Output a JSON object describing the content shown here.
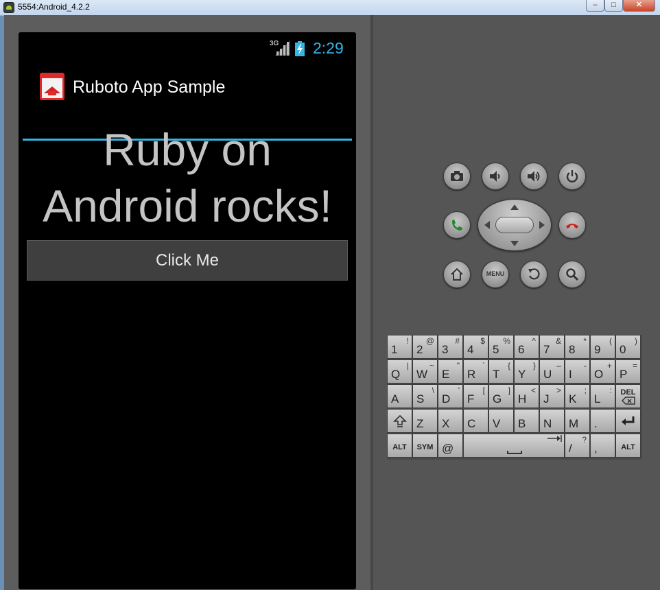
{
  "window": {
    "title": "5554:Android_4.2.2",
    "min": "–",
    "max": "□",
    "close": "✕"
  },
  "status": {
    "network": "3G",
    "time": "2:29",
    "accent": "#33b5e5"
  },
  "app": {
    "title": "Ruboto App Sample",
    "headline_1": "Ruby on",
    "headline_2": "Android rocks!",
    "button": "Click Me"
  },
  "hw_buttons": [
    "camera-icon",
    "volume-down-icon",
    "volume-up-icon",
    "power-icon",
    "call-icon",
    "end-call-icon",
    "home-icon",
    "menu",
    "back-icon",
    "search-icon"
  ],
  "menu_label": "MENU",
  "keyboard": {
    "row1": [
      [
        "1",
        "!"
      ],
      [
        "2",
        "@"
      ],
      [
        "3",
        "#"
      ],
      [
        "4",
        "$"
      ],
      [
        "5",
        "%"
      ],
      [
        "6",
        "^"
      ],
      [
        "7",
        "&"
      ],
      [
        "8",
        "*"
      ],
      [
        "9",
        "("
      ],
      [
        "0",
        ")"
      ]
    ],
    "row2": [
      [
        "Q",
        "|"
      ],
      [
        "W",
        "~"
      ],
      [
        "E",
        "\""
      ],
      [
        "R",
        "`"
      ],
      [
        "T",
        "{"
      ],
      [
        "Y",
        "}"
      ],
      [
        "U",
        "–"
      ],
      [
        "I",
        "-"
      ],
      [
        "O",
        "+"
      ],
      [
        "P",
        "="
      ]
    ],
    "row3": [
      [
        "A",
        ""
      ],
      [
        "S",
        "\\"
      ],
      [
        "D",
        "'"
      ],
      [
        "F",
        "["
      ],
      [
        "G",
        "]"
      ],
      [
        "H",
        "<"
      ],
      [
        "J",
        ">"
      ],
      [
        "K",
        ";"
      ],
      [
        "L",
        ":"
      ]
    ],
    "del": "DEL",
    "row4": [
      [
        "Z",
        ""
      ],
      [
        "X",
        ""
      ],
      [
        "C",
        ""
      ],
      [
        "V",
        ""
      ],
      [
        "B",
        ""
      ],
      [
        "N",
        ""
      ],
      [
        "M",
        ""
      ],
      [
        ".",
        ""
      ]
    ],
    "alt": "ALT",
    "sym": "SYM",
    "at": "@",
    "slash": [
      "/",
      "?"
    ],
    "comma": ","
  }
}
